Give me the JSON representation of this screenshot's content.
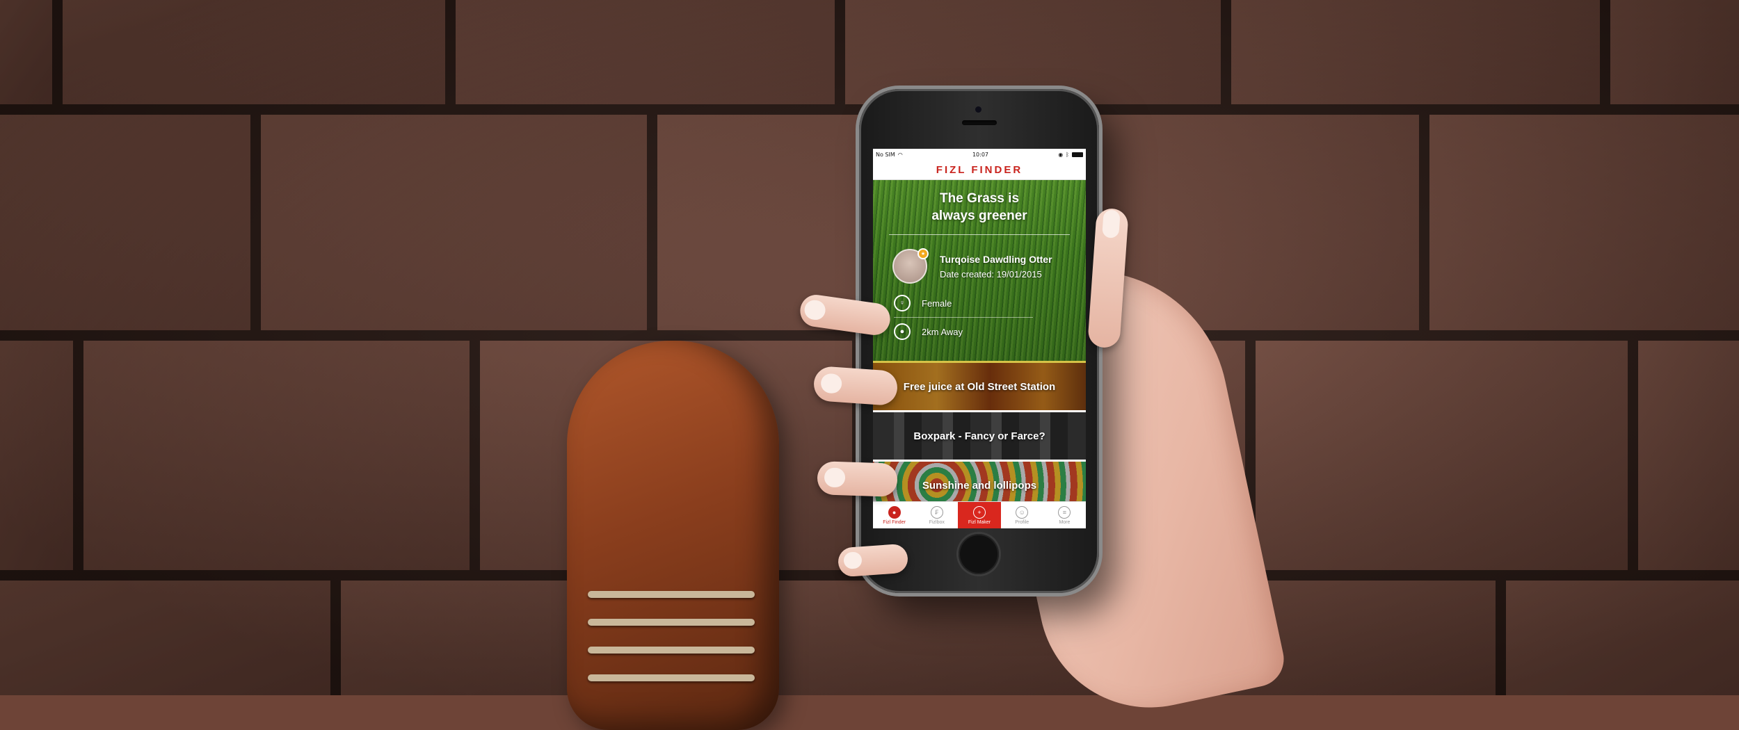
{
  "status_bar": {
    "carrier": "No SIM",
    "time": "10:07"
  },
  "app": {
    "title": "FIZL FINDER",
    "brand_color": "#c9231d"
  },
  "hero": {
    "title": "The Grass is always greener",
    "user_name": "Turqoise Dawdling Otter",
    "date_created": "Date created: 19/01/2015",
    "gender": "Female",
    "distance": "2km Away"
  },
  "cards": [
    {
      "title": "Free juice at Old Street Station"
    },
    {
      "title": "Boxpark - Fancy or Farce?"
    },
    {
      "title": "Sunshine and lollipops"
    }
  ],
  "tabs": [
    {
      "label": "Fizl Finder",
      "icon": "map-pin-icon"
    },
    {
      "label": "Fizlbox",
      "icon": "fizlbox-icon"
    },
    {
      "label": "Fizl Maker",
      "icon": "plus-icon"
    },
    {
      "label": "Profile",
      "icon": "profile-icon"
    },
    {
      "label": "More",
      "icon": "menu-icon"
    }
  ]
}
